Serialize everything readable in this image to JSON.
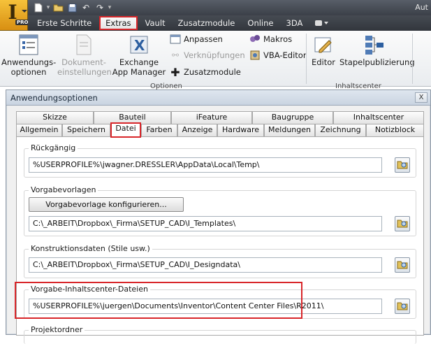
{
  "window": {
    "title": "Aut"
  },
  "app_button": {
    "logo_letter": "I",
    "badge": "PRO"
  },
  "ribbon_tabs": [
    {
      "label": "Erste Schritte"
    },
    {
      "label": "Extras",
      "active": true
    },
    {
      "label": "Vault"
    },
    {
      "label": "Zusatzmodule"
    },
    {
      "label": "Online"
    },
    {
      "label": "3DA"
    }
  ],
  "ribbon": {
    "anwendungsoptionen": "Anwendungs-\noptionen",
    "dokumenteinstellungen": "Dokument-\neinstellungen",
    "exchange": "Exchange\nApp Manager",
    "anpassen": "Anpassen",
    "verknuepfungen": "Verknüpfungen",
    "zusatzmodule": "Zusatzmodule",
    "makros": "Makros",
    "vba_editor": "VBA-Editor",
    "editor": "Editor",
    "stapelpublizierung": "Stapelpublizierung",
    "group_optionen": "Optionen",
    "group_inhaltscenter": "Inhaltscenter"
  },
  "dialog": {
    "title": "Anwendungsoptionen",
    "close_label": "X",
    "tabs_row1": [
      "Skizze",
      "Bauteil",
      "iFeature",
      "Baugruppe",
      "Inhaltscenter"
    ],
    "tabs_row2": [
      "Allgemein",
      "Speichern",
      "Datei",
      "Farben",
      "Anzeige",
      "Hardware",
      "Meldungen",
      "Zeichnung",
      "Notizblock"
    ],
    "active_tab": "Datei",
    "sections": {
      "rueckgaengig": {
        "label": "Rückgängig",
        "path": "%USERPROFILE%\\jwagner.DRESSLER\\AppData\\Local\\Temp\\"
      },
      "vorgabevorlagen": {
        "label": "Vorgabevorlagen",
        "button": "Vorgabevorlage konfigurieren...",
        "path": "C:\\_ARBEIT\\Dropbox\\_Firma\\SETUP_CAD\\I_Templates\\"
      },
      "konstruktionsdaten": {
        "label": "Konstruktionsdaten (Stile usw.)",
        "path": "C:\\_ARBEIT\\Dropbox\\_Firma\\SETUP_CAD\\I_Designdata\\"
      },
      "inhaltscenter": {
        "label": "Vorgabe-Inhaltscenter-Dateien",
        "path": "%USERPROFILE%\\juergen\\Documents\\Inventor\\Content Center Files\\R2011\\"
      },
      "projektordner": {
        "label": "Projektordner"
      }
    }
  },
  "colors": {
    "highlight": "#d8262a",
    "app_button": "#e8a520",
    "ribbon_dark": "#3b4048"
  }
}
